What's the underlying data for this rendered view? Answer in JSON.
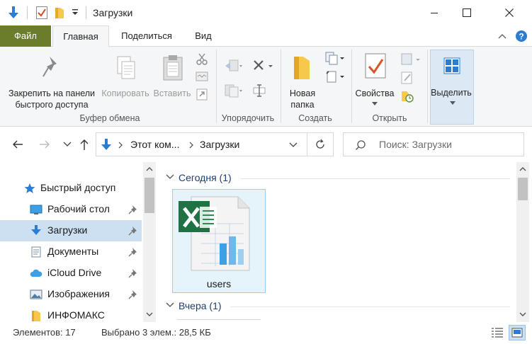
{
  "window": {
    "title": "Загрузки",
    "controls": [
      "minimize-icon",
      "maximize-icon",
      "close-icon"
    ]
  },
  "tabs": {
    "file": "Файл",
    "home": "Главная",
    "share": "Поделиться",
    "view": "Вид"
  },
  "ribbon": {
    "pin_line1": "Закрепить на панели",
    "pin_line2": "быстрого доступа",
    "copy": "Копировать",
    "paste": "Вставить",
    "clipboard_group": "Буфер обмена",
    "organize_group": "Упорядочить",
    "new_folder_line1": "Новая",
    "new_folder_line2": "папка",
    "create_group": "Создать",
    "properties": "Свойства",
    "open_group": "Открыть",
    "select": "Выделить"
  },
  "address": {
    "crumb1": "Этот ком...",
    "crumb2": "Загрузки",
    "search_placeholder": "Поиск: Загрузки"
  },
  "navpane": {
    "items": [
      {
        "label": "Быстрый доступ",
        "icon": "star-icon"
      },
      {
        "label": "Рабочий стол",
        "icon": "desktop-icon",
        "pinned": true
      },
      {
        "label": "Загрузки",
        "icon": "download-icon",
        "pinned": true,
        "selected": true
      },
      {
        "label": "Документы",
        "icon": "document-icon",
        "pinned": true
      },
      {
        "label": "iCloud Drive",
        "icon": "cloud-icon",
        "pinned": true
      },
      {
        "label": "Изображения",
        "icon": "image-icon",
        "pinned": true
      },
      {
        "label": "ИНФОМАКС",
        "icon": "folder-icon"
      }
    ]
  },
  "content": {
    "group_today": "Сегодня (1)",
    "group_yesterday": "Вчера (1)",
    "file_name": "users"
  },
  "status": {
    "items": "Элементов: 17",
    "selected": "Выбрано 3 элем.: 28,5 КБ"
  },
  "colors": {
    "file_tab": "#6b7d2b",
    "selection": "#cce0f2",
    "tile_bg": "#e5f3fb",
    "accent_blue": "#2b7cd3",
    "excel_green": "#1f7244"
  }
}
